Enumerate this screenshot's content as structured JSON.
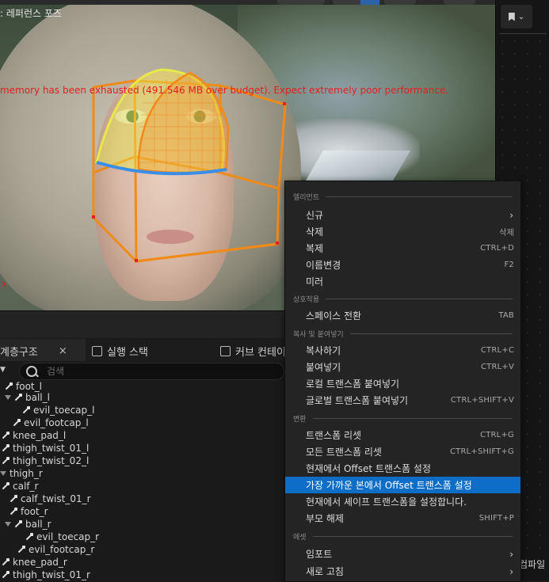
{
  "viewport": {
    "mode_label": ": 레퍼런스 포즈",
    "warning": "memory has been exhausted (491.546 MB over budget). Expect extremely poor performance.",
    "axis_x": "x"
  },
  "right_panel": {
    "icon": "bookmark-icon",
    "chevron": "⌄",
    "compile_label": "컴파일"
  },
  "tabs": [
    {
      "label": "계층구조",
      "close": "×"
    },
    {
      "label": "실행 스택"
    },
    {
      "label": "커브 컨테이"
    }
  ],
  "search": {
    "placeholder": "검색",
    "value": ""
  },
  "tree": [
    {
      "label": "foot_l",
      "depth": 1
    },
    {
      "label": "ball_l",
      "depth": 2
    },
    {
      "label": "evil_toecap_l",
      "depth": 3
    },
    {
      "label": "evil_footcap_l",
      "depth": 2
    },
    {
      "label": "knee_pad_l",
      "depth": 0
    },
    {
      "label": "thigh_twist_01_l",
      "depth": 0
    },
    {
      "label": "thigh_twist_02_l",
      "depth": 0
    },
    {
      "label": "thigh_r",
      "depth": 0
    },
    {
      "label": "calf_r",
      "depth": 0
    },
    {
      "label": "calf_twist_01_r",
      "depth": 1
    },
    {
      "label": "foot_r",
      "depth": 1
    },
    {
      "label": "ball_r",
      "depth": 2
    },
    {
      "label": "evil_toecap_r",
      "depth": 3
    },
    {
      "label": "evil_footcap_r",
      "depth": 2
    },
    {
      "label": "knee_pad_r",
      "depth": 0
    },
    {
      "label": "thigh_twist_01_r",
      "depth": 0
    }
  ],
  "menu": {
    "sections": {
      "element": "엘리먼트",
      "interaction": "상호작용",
      "copy_paste": "복사 및 붙여넣기",
      "transform": "변환",
      "asset": "에셋"
    },
    "items": [
      {
        "label": "신규",
        "shortcut": "",
        "submenu": true
      },
      {
        "label": "삭제",
        "shortcut": "삭제"
      },
      {
        "label": "복제",
        "shortcut": "CTRL+D"
      },
      {
        "label": "이름변경",
        "shortcut": "F2"
      },
      {
        "label": "미러",
        "shortcut": ""
      },
      {
        "label": "스페이스 전환",
        "shortcut": "TAB"
      },
      {
        "label": "복사하기",
        "shortcut": "CTRL+C"
      },
      {
        "label": "붙여넣기",
        "shortcut": "CTRL+V"
      },
      {
        "label": "로컬 트랜스폼 붙여넣기",
        "shortcut": ""
      },
      {
        "label": "글로벌 트랜스폼 붙여넣기",
        "shortcut": "CTRL+SHIFT+V"
      },
      {
        "label": "트랜스폼 리셋",
        "shortcut": "CTRL+G"
      },
      {
        "label": "모든 트랜스폼 리셋",
        "shortcut": "CTRL+SHIFT+G"
      },
      {
        "label": "현재에서 Offset 트랜스폼 설정",
        "shortcut": ""
      },
      {
        "label": "가장 가까운 본에서 Offset 트랜스폼 설정",
        "shortcut": "",
        "highlighted": true
      },
      {
        "label": "현재에서 셰이프 트랜스폼을 설정합니다.",
        "shortcut": ""
      },
      {
        "label": "부모 해제",
        "shortcut": "SHIFT+P"
      },
      {
        "label": "임포트",
        "shortcut": "",
        "submenu": true
      },
      {
        "label": "새로 고침",
        "shortcut": "",
        "submenu": true
      }
    ],
    "submenu_chevron": "›"
  },
  "colors": {
    "highlight": "#0e6ec7",
    "warning": "#e21f1f",
    "gizmo_orange": "#f08a18",
    "gizmo_yellow": "#e8e84a",
    "gizmo_blue": "#3b8ee8"
  }
}
